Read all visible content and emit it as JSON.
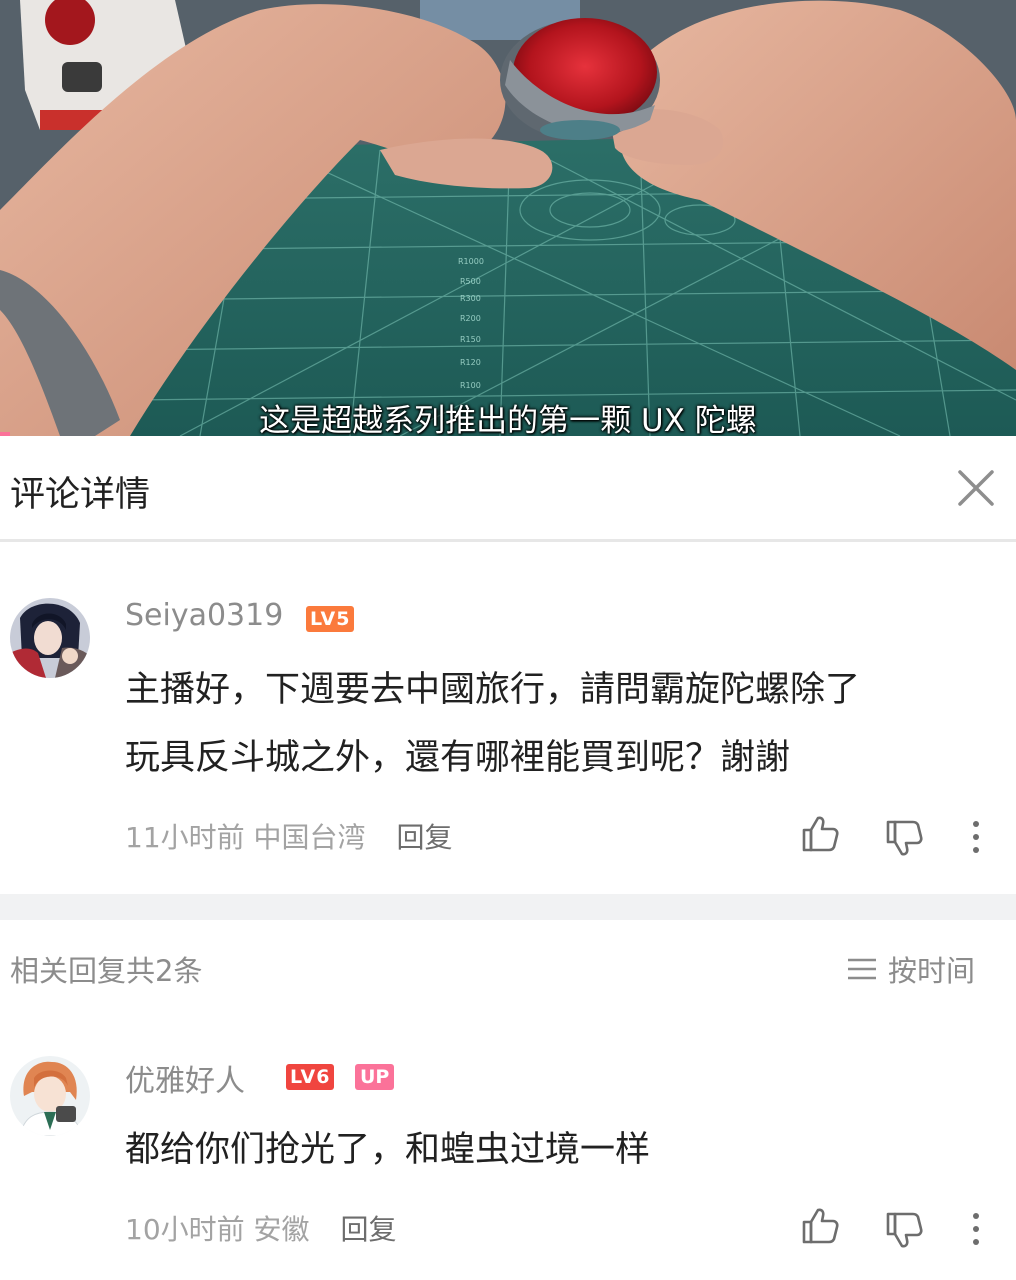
{
  "video": {
    "subtitle": "这是超越系列推出的第一颗 UX 陀螺",
    "mat_labels": [
      "R1000",
      "R500",
      "R300",
      "R200",
      "R150",
      "R120",
      "R100"
    ]
  },
  "header": {
    "title": "评论详情",
    "close_icon": "close-icon"
  },
  "main_comment": {
    "username": "Seiya0319",
    "level": "LV5",
    "text_line1": "主播好，下週要去中國旅行，請問霸旋陀螺除了",
    "text_line2": "玩具反斗城之外，還有哪裡能買到呢？謝謝",
    "time": "11小时前",
    "location": "中国台湾",
    "reply_label": "回复"
  },
  "replies_bar": {
    "count_label": "相关回复共2条",
    "sort_label": "按时间"
  },
  "reply_comment": {
    "username": "优雅好人",
    "level": "LV6",
    "up_badge": "UP",
    "text": "都给你们抢光了，和蝗虫过境一样",
    "time": "10小时前",
    "location": "安徽",
    "reply_label": "回复"
  },
  "colors": {
    "lv5": "#fb7a3c",
    "lv6": "#f0453f",
    "up": "#fb7299",
    "muted": "#8c8c8c",
    "divider": "#f1f2f3"
  }
}
